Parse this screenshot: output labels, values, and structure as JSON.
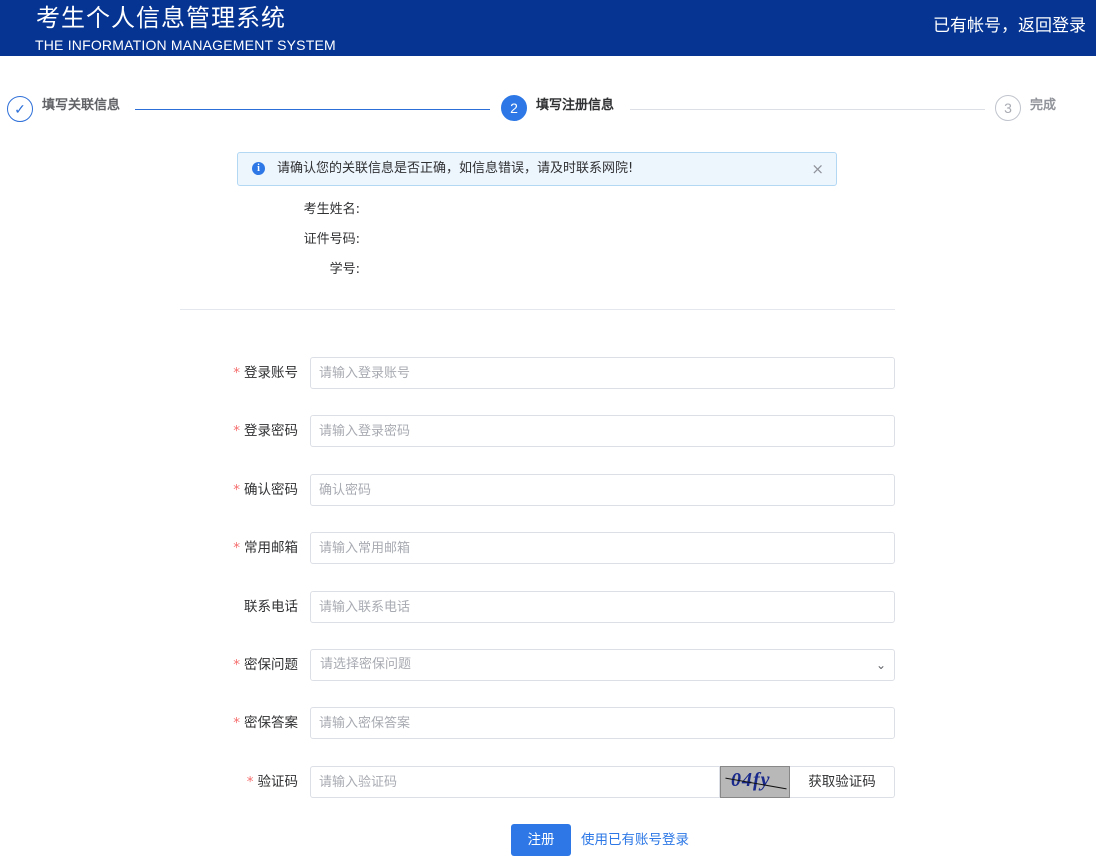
{
  "header": {
    "title": "考生个人信息管理系统",
    "subtitle": "THE INFORMATION MANAGEMENT SYSTEM",
    "login_link": "已有帐号，返回登录",
    "bg_color": "#063492"
  },
  "steps": [
    {
      "number": "✓",
      "label": "填写关联信息",
      "status": "done"
    },
    {
      "number": "2",
      "label": "填写注册信息",
      "status": "active"
    },
    {
      "number": "3",
      "label": "完成",
      "status": "todo"
    }
  ],
  "alert": {
    "icon": "info-icon",
    "text": "请确认您的关联信息是否正确，如信息错误，请及时联系网院!",
    "close": "×"
  },
  "info": {
    "name_label": "考生姓名:",
    "id_label": "证件号码:",
    "student_no_label": "学号:"
  },
  "form": {
    "account": {
      "label": "登录账号",
      "placeholder": "请输入登录账号",
      "value": "",
      "required": true
    },
    "password": {
      "label": "登录密码",
      "placeholder": "请输入登录密码",
      "value": "",
      "required": true
    },
    "confirm": {
      "label": "确认密码",
      "placeholder": "确认密码",
      "value": "",
      "required": true
    },
    "email": {
      "label": "常用邮箱",
      "placeholder": "请输入常用邮箱",
      "value": "",
      "required": true
    },
    "phone": {
      "label": "联系电话",
      "placeholder": "请输入联系电话",
      "value": "",
      "required": false
    },
    "question": {
      "label": "密保问题",
      "placeholder": "请选择密保问题",
      "required": true
    },
    "answer": {
      "label": "密保答案",
      "placeholder": "请输入密保答案",
      "value": "",
      "required": true
    },
    "captcha": {
      "label": "验证码",
      "placeholder": "请输入验证码",
      "value": "",
      "required": true,
      "image_text": "04fy",
      "button": "获取验证码"
    }
  },
  "required_mark": "*",
  "actions": {
    "submit": "注册",
    "existing": "使用已有账号登录",
    "accent": "#2d78e6"
  }
}
